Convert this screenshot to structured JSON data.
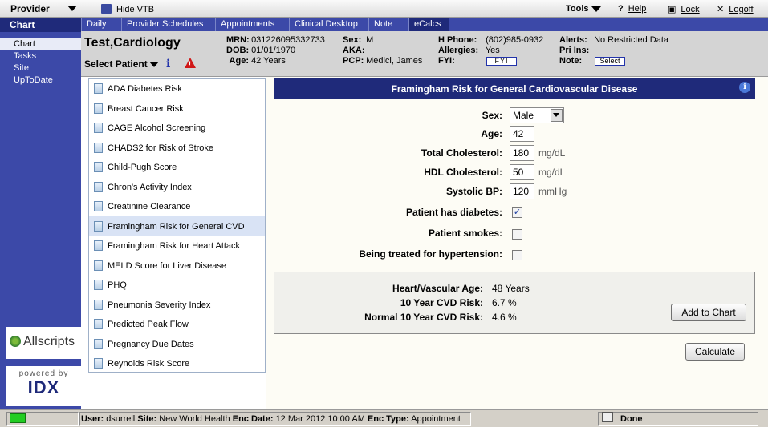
{
  "topbar": {
    "provider_label": "Provider",
    "hide_vtb": "Hide VTB",
    "tools": "Tools",
    "help": "Help",
    "lock": "Lock",
    "logoff": "Logoff"
  },
  "leftnav": {
    "header": "Chart",
    "items": [
      "Chart",
      "Tasks",
      "Site",
      "UpToDate"
    ],
    "logo": "Allscripts",
    "powered_by": "powered by",
    "powered_brand": "IDX"
  },
  "tabs": [
    "Daily",
    "Provider Schedules",
    "Appointments",
    "Clinical Desktop",
    "Note",
    "eCalcs"
  ],
  "patient": {
    "name": "Test,Cardiology",
    "select_label": "Select Patient",
    "mrn_label": "MRN:",
    "mrn": "031226095332733",
    "dob_label": "DOB:",
    "dob": "01/01/1970",
    "age_label": "Age:",
    "age": "42 Years",
    "sex_label": "Sex:",
    "sex": "M",
    "aka_label": "AKA:",
    "aka": "",
    "pcp_label": "PCP:",
    "pcp": "Medici, James",
    "hphone_label": "H Phone:",
    "hphone": "(802)985-0932",
    "allergies_label": "Allergies:",
    "allergies": "Yes",
    "fyi_label": "FYI:",
    "fyi_button": "FYI",
    "alerts_label": "Alerts:",
    "alerts": "No Restricted Data",
    "priins_label": "Pri Ins:",
    "priins": "",
    "note_label": "Note:",
    "note_button": "Select"
  },
  "calculators": [
    "ADA Diabetes Risk",
    "Breast Cancer Risk",
    "CAGE Alcohol Screening",
    "CHADS2 for Risk of Stroke",
    "Child-Pugh Score",
    "Chron's Activity Index",
    "Creatinine Clearance",
    "Framingham Risk for General CVD",
    "Framingham Risk for Heart Attack",
    "MELD Score for Liver Disease",
    "PHQ",
    "Pneumonia Severity Index",
    "Predicted Peak Flow",
    "Pregnancy Due Dates",
    "Reynolds Risk Score"
  ],
  "form": {
    "title": "Framingham Risk for General Cardiovascular Disease",
    "sex_label": "Sex:",
    "sex_value": "Male",
    "age_label": "Age:",
    "age_value": "42",
    "tc_label": "Total Cholesterol:",
    "tc_value": "180",
    "tc_unit": "mg/dL",
    "hdl_label": "HDL Cholesterol:",
    "hdl_value": "50",
    "hdl_unit": "mg/dL",
    "sbp_label": "Systolic BP:",
    "sbp_value": "120",
    "sbp_unit": "mmHg",
    "diabetes_label": "Patient has diabetes:",
    "smokes_label": "Patient smokes:",
    "htn_label": "Being treated for hypertension:"
  },
  "results": {
    "hv_age_label": "Heart/Vascular Age:",
    "hv_age": "48 Years",
    "risk_label": "10 Year CVD Risk:",
    "risk": "6.7 %",
    "normal_label": "Normal 10 Year CVD Risk:",
    "normal": "4.6 %",
    "add_button": "Add to Chart",
    "calculate_button": "Calculate"
  },
  "status": {
    "user_label": "User:",
    "user": "dsurrell",
    "site_label": "Site:",
    "site": "New World Health",
    "encdate_label": "Enc Date:",
    "encdate": "12 Mar 2012 10:00 AM",
    "enctype_label": "Enc Type:",
    "enctype": "Appointment",
    "done": "Done"
  }
}
